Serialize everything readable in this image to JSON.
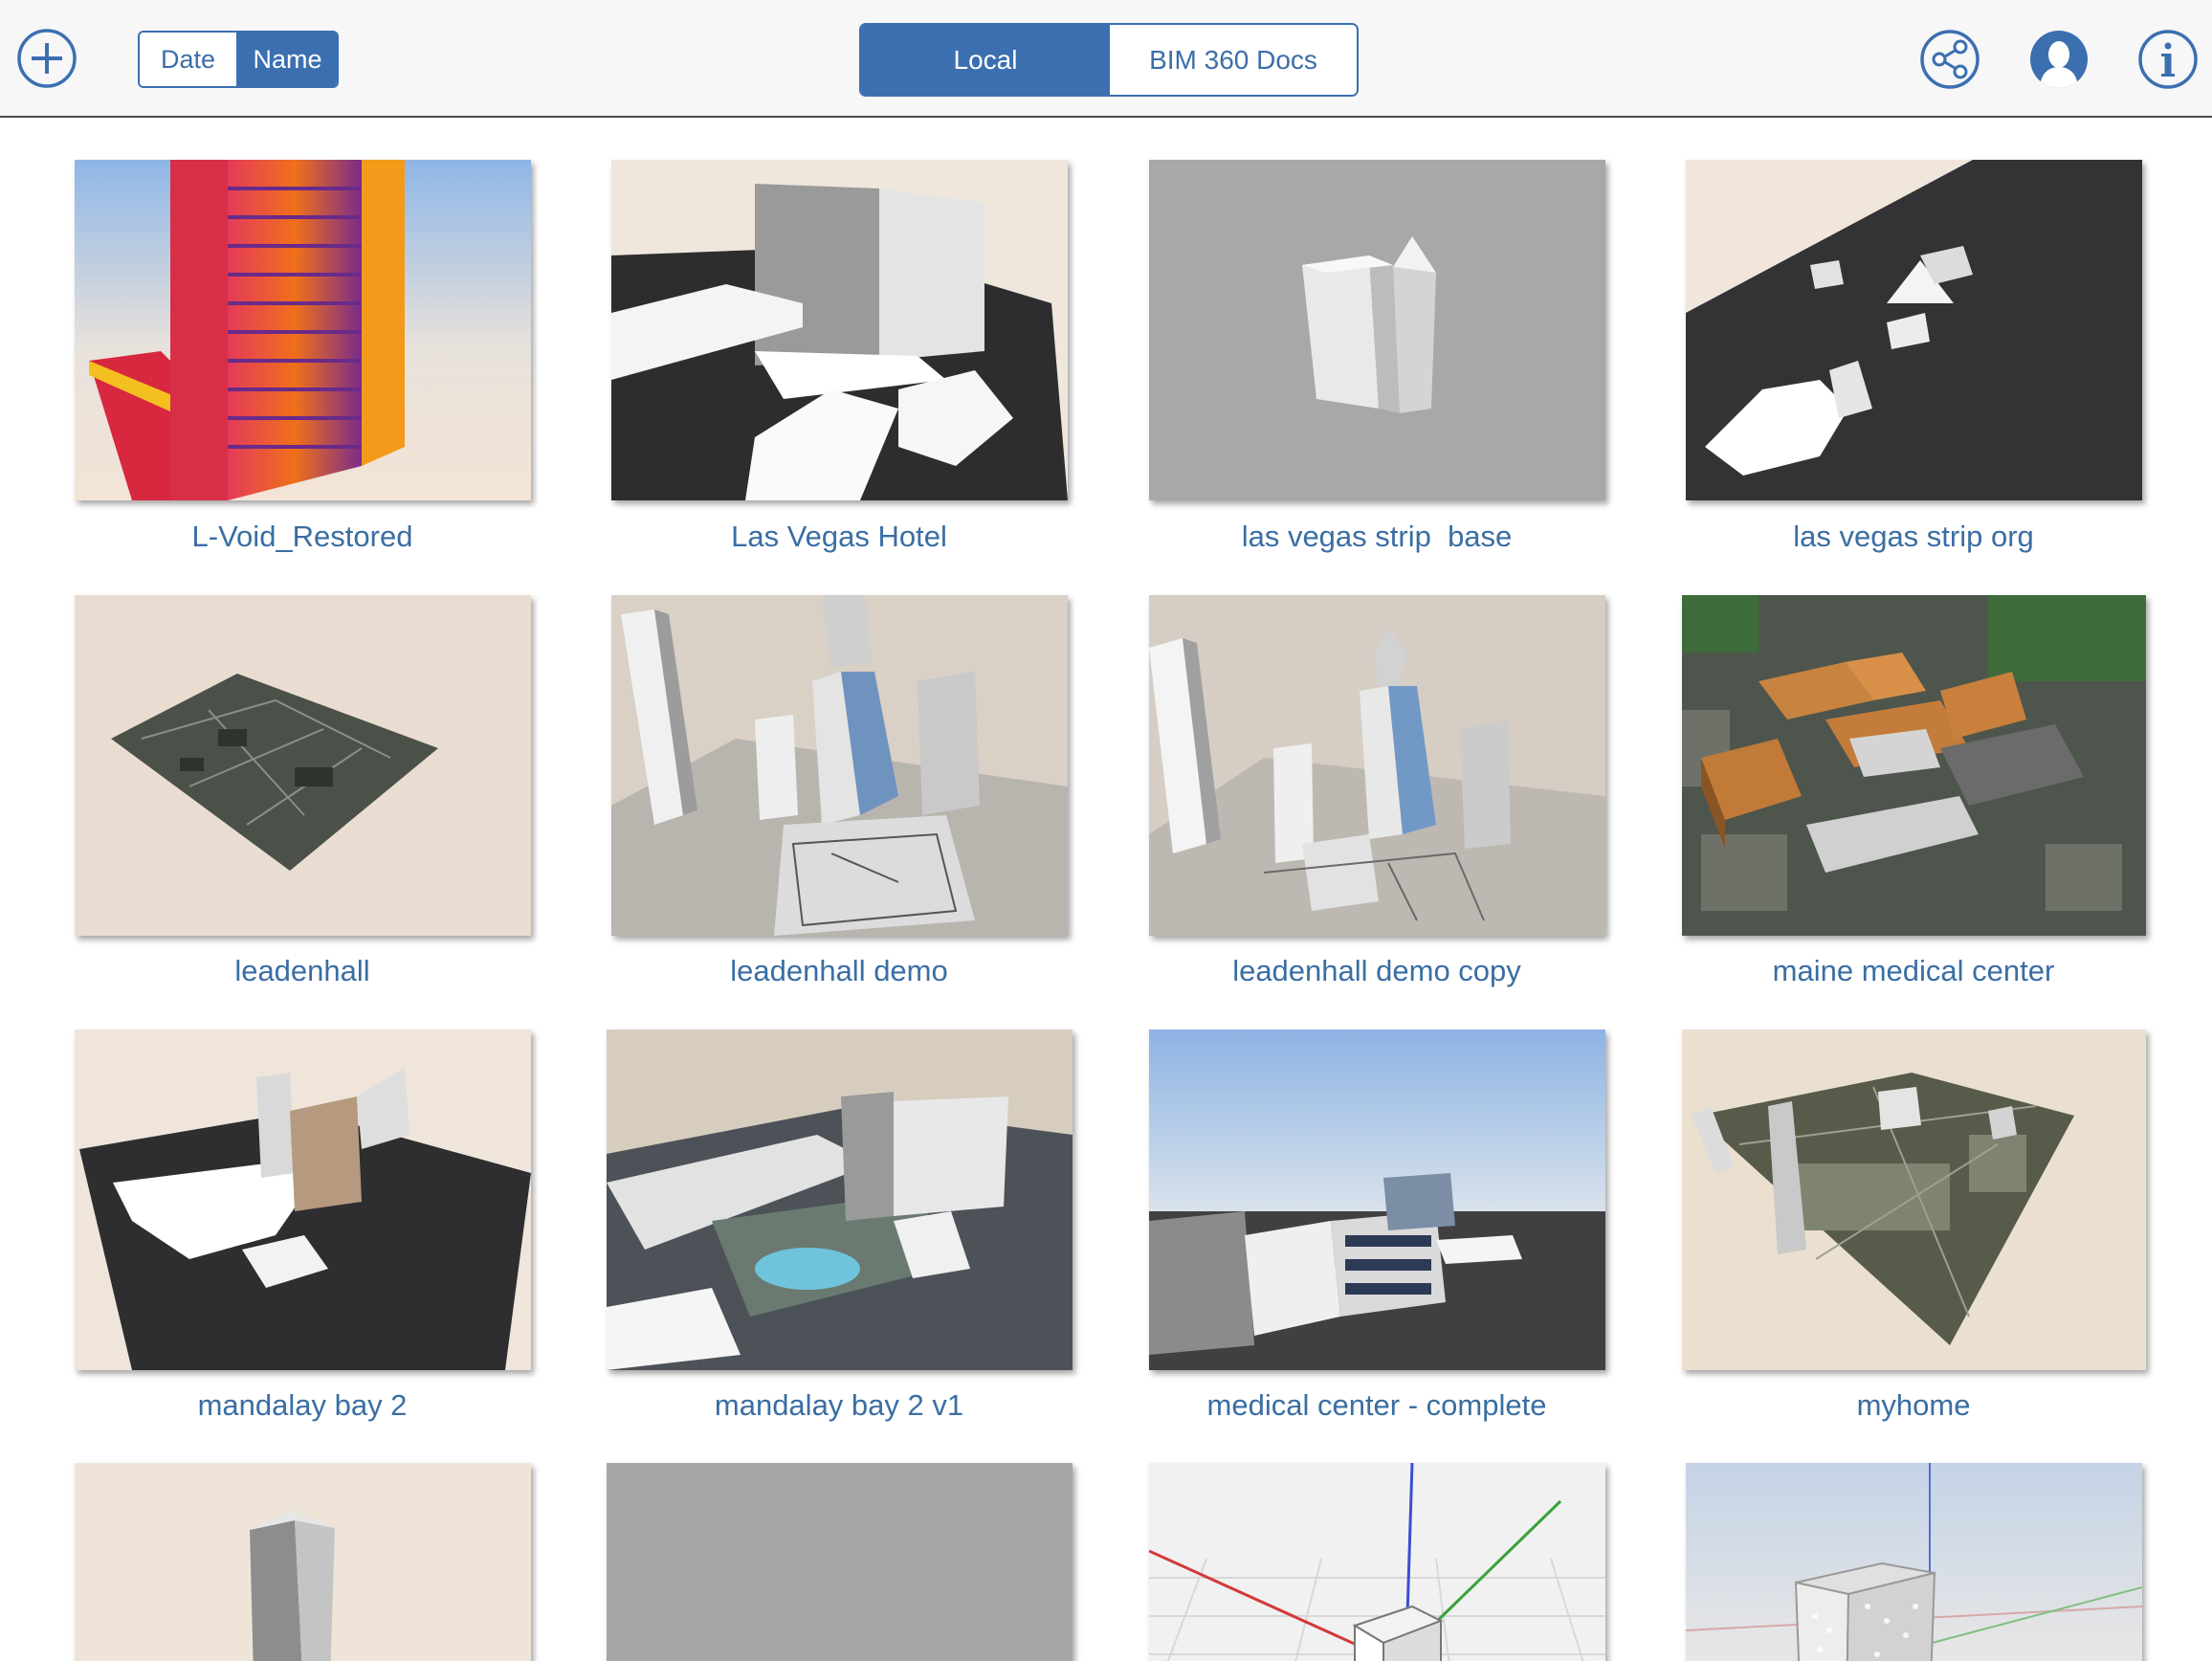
{
  "toolbar": {
    "add_icon": "plus-circle-icon",
    "sort": {
      "options": [
        "Date",
        "Name"
      ],
      "selected": "Name"
    },
    "source": {
      "options": [
        "Local",
        "BIM 360 Docs"
      ],
      "selected": "Local"
    },
    "share_icon": "share-icon",
    "account_icon": "user-icon",
    "info_icon": "info-icon",
    "accent_color": "#3b6fb0"
  },
  "models": [
    {
      "name": "L-Void_Restored"
    },
    {
      "name": "Las Vegas Hotel"
    },
    {
      "name": "las vegas strip  base"
    },
    {
      "name": "las vegas strip org"
    },
    {
      "name": "leadenhall"
    },
    {
      "name": "leadenhall demo"
    },
    {
      "name": "leadenhall demo copy"
    },
    {
      "name": "maine medical center"
    },
    {
      "name": "mandalay bay 2"
    },
    {
      "name": "mandalay bay 2 v1"
    },
    {
      "name": "medical center - complete"
    },
    {
      "name": "myhome"
    },
    {
      "name": ""
    },
    {
      "name": ""
    },
    {
      "name": ""
    },
    {
      "name": ""
    }
  ]
}
